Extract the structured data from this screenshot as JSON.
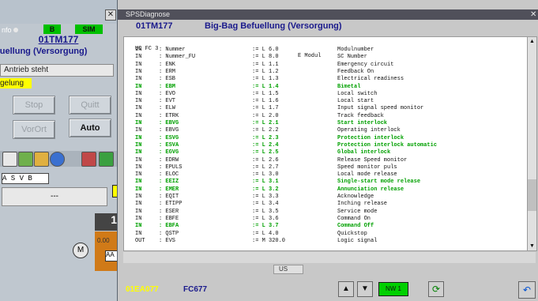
{
  "left_panel": {
    "close_glyph": "✕",
    "info_label": "nfo",
    "badge_b": "B",
    "badge_sim": "SIM",
    "title": "01TM177",
    "subtitle": "efuellung (Versorgung)",
    "status": "Antrieb steht",
    "mode": "gelung",
    "buttons": {
      "stop": "Stop",
      "quitt": "Quitt",
      "vorort": "VorOrt",
      "auto": "Auto"
    },
    "tab_label": "A S V B",
    "dash": "---",
    "indicator": "1",
    "value": "0.00",
    "aa_label": "AA",
    "motor_label": "M"
  },
  "window": {
    "title": "SPSDiagnose",
    "close_glyph": "✕",
    "header_left": "01TM177",
    "header_title": "Big-Bag Befuellung (Versorgung)"
  },
  "listing": {
    "header": [
      "UC FC 3",
      "E Modul"
    ],
    "rows": [
      {
        "t": "IN",
        "n": "Nummer",
        "a": ":= L 6.0",
        "d": "Modulnumber",
        "h": false
      },
      {
        "t": "IN",
        "n": "Nummer_FU",
        "a": ":= L 8.0",
        "d": "SC Number",
        "h": false
      },
      {
        "t": "IN",
        "n": "ENK",
        "a": ":= L 1.1",
        "d": "Emergency circuit",
        "h": false
      },
      {
        "t": "IN",
        "n": "ERM",
        "a": ":= L 1.2",
        "d": "Feedback On",
        "h": false
      },
      {
        "t": "IN",
        "n": "ESB",
        "a": ":= L 1.3",
        "d": "Electrical readiness",
        "h": false
      },
      {
        "t": "IN",
        "n": "EBM",
        "a": ":= L 1.4",
        "d": "Bimetal",
        "h": true
      },
      {
        "t": "IN",
        "n": "EVO",
        "a": ":= L 1.5",
        "d": "Local switch",
        "h": false
      },
      {
        "t": "IN",
        "n": "EVT",
        "a": ":= L 1.6",
        "d": "Local start",
        "h": false
      },
      {
        "t": "IN",
        "n": "ELW",
        "a": ":= L 1.7",
        "d": "Input signal speed monitor",
        "h": false
      },
      {
        "t": "IN",
        "n": "ETRK",
        "a": ":= L 2.0",
        "d": "Track feedback",
        "h": false
      },
      {
        "t": "IN",
        "n": "EBVG",
        "a": ":= L 2.1",
        "d": "Start interlock",
        "h": true
      },
      {
        "t": "IN",
        "n": "EBVG",
        "a": ":= L 2.2",
        "d": "Operating interlock",
        "h": false
      },
      {
        "t": "IN",
        "n": "ESVG",
        "a": ":= L 2.3",
        "d": "Protection interlock",
        "h": true
      },
      {
        "t": "IN",
        "n": "ESVA",
        "a": ":= L 2.4",
        "d": "Protection interlock automatic",
        "h": true
      },
      {
        "t": "IN",
        "n": "EGVG",
        "a": ":= L 2.5",
        "d": "Global interlock",
        "h": true
      },
      {
        "t": "IN",
        "n": "EDRW",
        "a": ":= L 2.6",
        "d": "Release Speed monitor",
        "h": false
      },
      {
        "t": "IN",
        "n": "EPULS",
        "a": ":= L 2.7",
        "d": "Speed monitor puls",
        "h": false
      },
      {
        "t": "IN",
        "n": "ELOC",
        "a": ":= L 3.0",
        "d": "Local mode release",
        "h": false
      },
      {
        "t": "IN",
        "n": "EEIZ",
        "a": ":= L 3.1",
        "d": "Single-start mode release",
        "h": true
      },
      {
        "t": "IN",
        "n": "EMER",
        "a": ":= L 3.2",
        "d": "Annunciation release",
        "h": true
      },
      {
        "t": "IN",
        "n": "EQIT",
        "a": ":= L 3.3",
        "d": "Acknowledge",
        "h": false
      },
      {
        "t": "IN",
        "n": "ETIPP",
        "a": ":= L 3.4",
        "d": "Inching release",
        "h": false
      },
      {
        "t": "IN",
        "n": "ESER",
        "a": ":= L 3.5",
        "d": "Service mode",
        "h": false
      },
      {
        "t": "IN",
        "n": "EBFE",
        "a": ":= L 3.6",
        "d": "Command On",
        "h": false
      },
      {
        "t": "IN",
        "n": "EBFA",
        "a": ":= L 3.7",
        "d": "Command Off",
        "h": true
      },
      {
        "t": "IN",
        "n": "QSTP",
        "a": ":= L 4.0",
        "d": "Quickstop",
        "h": false
      },
      {
        "t": "OUT",
        "n": "EVS",
        "a": ":= M 320.0",
        "d": "Logic signal",
        "h": false
      }
    ]
  },
  "status_field": "US",
  "footer": {
    "left_tag": "01EA077",
    "fc": "FC677",
    "up": "▲",
    "down": "▼",
    "nw": "NW  1",
    "refresh": "⟳",
    "home": "↶"
  },
  "scroll": {
    "up": "▲",
    "down": "▼"
  }
}
